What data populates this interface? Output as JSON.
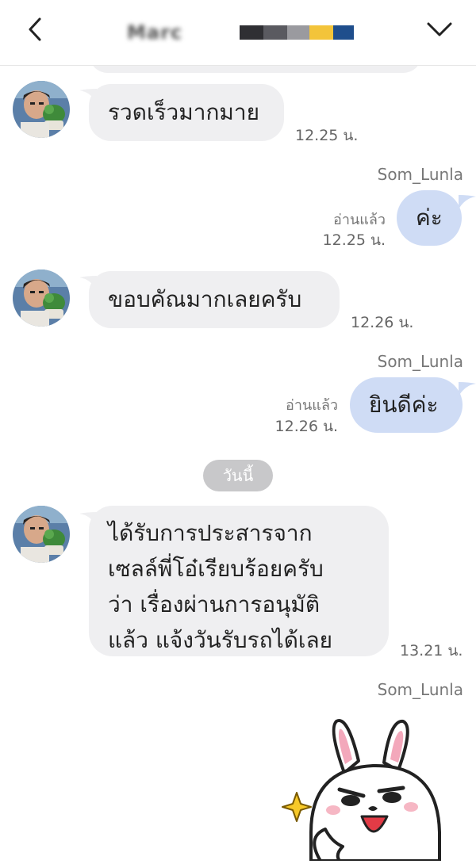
{
  "header": {
    "title": "Marc",
    "censor_colors": [
      "#2f2f33",
      "#9a9a9f",
      "#f3c43a",
      "#1f4e8c"
    ]
  },
  "messages": [
    {
      "side": "in",
      "text": "รวดเร็วมากมาย",
      "time": "12.25 น."
    },
    {
      "side": "out",
      "sender": "Som_Lunla",
      "text": "ค่ะ",
      "read": "อ่านแล้ว",
      "time": "12.25 น."
    },
    {
      "side": "in",
      "text": "ขอบคัณมากเลยครับ",
      "time": "12.26 น."
    },
    {
      "side": "out",
      "sender": "Som_Lunla",
      "text": "ยินดีค่ะ",
      "read": "อ่านแล้ว",
      "time": "12.26 น."
    },
    {
      "date_separator": "วันนี้"
    },
    {
      "side": "in",
      "lines": [
        "ได้รับการประสารจาก",
        "เซลล์พี่โอ๋เรียบร้อยครับ",
        "ว่า เรื่องผ่านการอนุมัติ",
        "แล้ว แจ้งวันรับรถได้เลย"
      ],
      "time": "13.21 น."
    },
    {
      "side": "out",
      "sender": "Som_Lunla",
      "sticker": "bunny-sticker"
    }
  ],
  "colors": {
    "incoming_bubble": "#efeff1",
    "outgoing_bubble": "#cfdcf5",
    "date_pill": "#c8c8ca"
  }
}
